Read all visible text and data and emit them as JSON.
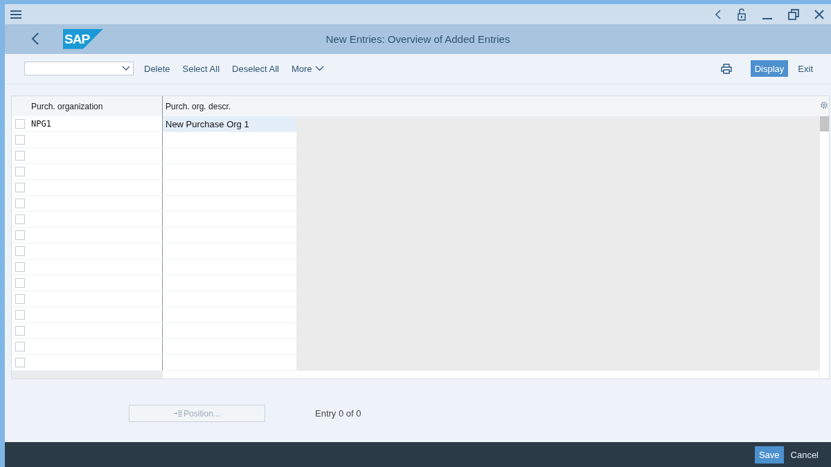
{
  "window": {
    "title": "New Entries: Overview of Added Entries"
  },
  "logo": "SAP",
  "toolbar": {
    "actions": [
      "Delete",
      "Select All",
      "Deselect All"
    ],
    "more": "More",
    "right_buttons": [
      {
        "label": "Display",
        "selected": true
      },
      {
        "label": "Exit",
        "selected": false
      }
    ]
  },
  "table": {
    "columns": [
      "Purch. organization",
      "Purch. org. descr."
    ],
    "rows": [
      {
        "selected": false,
        "cells": [
          "NPG1",
          "New Purchase Org 1"
        ]
      },
      {
        "selected": false,
        "cells": []
      },
      {
        "selected": false,
        "cells": []
      },
      {
        "selected": false,
        "cells": []
      },
      {
        "selected": false,
        "cells": []
      },
      {
        "selected": false,
        "cells": []
      },
      {
        "selected": false,
        "cells": []
      },
      {
        "selected": false,
        "cells": []
      },
      {
        "selected": false,
        "cells": []
      },
      {
        "selected": false,
        "cells": []
      },
      {
        "selected": false,
        "cells": []
      },
      {
        "selected": false,
        "cells": []
      },
      {
        "selected": false,
        "cells": []
      },
      {
        "selected": false,
        "cells": []
      },
      {
        "selected": false,
        "cells": []
      },
      {
        "selected": false,
        "cells": []
      }
    ]
  },
  "position_button": {
    "label": "Position...",
    "disabled": true
  },
  "entry_count": "Entry 0 of 0",
  "footer": {
    "buttons": [
      {
        "label": "Save",
        "selected": true
      },
      {
        "label": "Cancel",
        "selected": false
      }
    ]
  }
}
